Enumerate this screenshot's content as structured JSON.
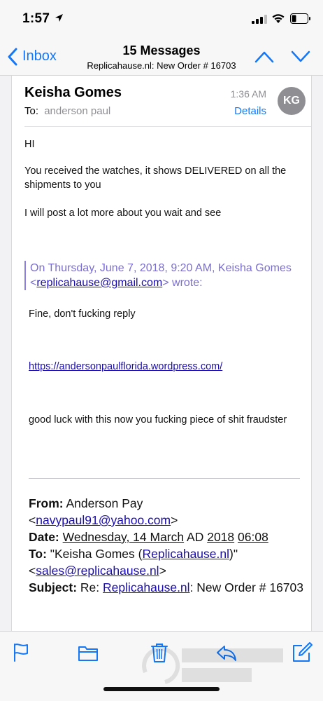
{
  "status_bar": {
    "time": "1:57"
  },
  "nav": {
    "back_label": "Inbox",
    "title": "15 Messages",
    "subtitle": "Replicahause.nl: New Order # 16703"
  },
  "email": {
    "sender": "Keisha Gomes",
    "to_label": "To:",
    "to_name": "anderson paul",
    "time": "1:36 AM",
    "details_label": "Details",
    "avatar_initials": "KG",
    "greeting": "HI",
    "para1": "You received the watches, it shows DELIVERED on all the shipments to you",
    "para2": "I will post  a lot more about you wait and see",
    "quote_header_pre": "On Thursday, June 7, 2018, 9:20 AM, Keisha Gomes <",
    "quote_header_email": "replicahause@gmail.com",
    "quote_header_post": "> wrote:",
    "quoted_line1": "Fine, don't fucking reply",
    "quoted_link": "https://andersonpaulflorida.wordpress.com/",
    "quoted_line2": "good luck with this now you fucking piece of shit fraudster",
    "from_label": "From:",
    "from_name": "Anderson Pay",
    "from_email_open": "<",
    "from_email": "navypaul91@yahoo.com",
    "from_email_close": ">",
    "date_label": "Date:",
    "date_value": "Wednesday, 14 March",
    "date_era": "AD",
    "date_year": "2018",
    "date_time": "06:08",
    "to_field_label": "To:",
    "to_field_pre": "\"Keisha Gomes (",
    "to_field_link": "Replicahause.nl",
    "to_field_post": ")\"",
    "to_field_email_open": "<",
    "to_field_email": "sales@replicahause.nl",
    "to_field_email_close": ">",
    "subject_label": "Subject:",
    "subject_pre": "Re:",
    "subject_link": "Replicahause.nl",
    "subject_post": ": New Order # 16703"
  },
  "toolbar": {
    "icons": [
      "flag-icon",
      "folder-icon",
      "trash-icon",
      "reply-icon",
      "compose-icon"
    ]
  },
  "colors": {
    "accent": "#1477f8",
    "quote": "#7a6fd0",
    "link": "#1a0dab"
  }
}
